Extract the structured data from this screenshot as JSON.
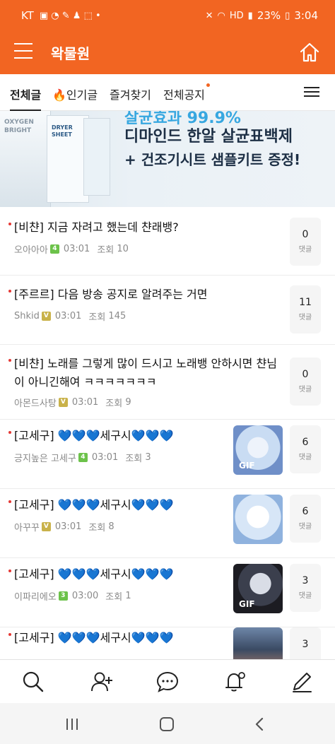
{
  "status_bar": {
    "carrier": "KT",
    "battery": "23%",
    "time": "3:04",
    "icons": [
      "mute-icon",
      "wifi-icon",
      "hd-icon",
      "signal-icon",
      "battery-icon"
    ]
  },
  "header": {
    "title": "왁물원",
    "menu_icon": "hamburger-icon",
    "home_icon": "home-icon",
    "color": "#f26522"
  },
  "tabs": [
    {
      "label": "전체글",
      "active": true
    },
    {
      "label": "🔥인기글",
      "active": false
    },
    {
      "label": "즐겨찾기",
      "active": false
    },
    {
      "label": "전체공지",
      "active": false,
      "new_dot": true
    }
  ],
  "banner": {
    "line1": "살균효과 99.9%",
    "line2": "디마인드 한알 살균표백제",
    "line3": "+ 건조기시트 샘플키트 증정!",
    "bottle_text": "OXYGEN BRIGHT",
    "pack_text": "DRYER SHEET"
  },
  "posts": [
    {
      "title": "[비챤] 지금 자려고 했는데 챤래뱅?",
      "author": "오아아아",
      "level": "4",
      "level_color": "#6cc24a",
      "time": "03:01",
      "views_label": "조회",
      "views": "10",
      "comments": "0",
      "comment_label": "댓글",
      "thumb": null
    },
    {
      "title": "[주르르] 다음 방송 공지로 알려주는 거면",
      "author": "Shkid",
      "level": "V",
      "level_color": "#c9b24a",
      "time": "03:01",
      "views_label": "조회",
      "views": "145",
      "comments": "11",
      "comment_label": "댓글",
      "thumb": null
    },
    {
      "title": "[비챤] 노래를 그렇게 많이 드시고 노래뱅 안하시면 챤님이 아니긴해여 ㅋㅋㅋㅋㅋㅋㅋ",
      "author": "아몬드사탕",
      "level": "V",
      "level_color": "#c9b24a",
      "time": "03:01",
      "views_label": "조회",
      "views": "9",
      "comments": "0",
      "comment_label": "댓글",
      "thumb": null
    },
    {
      "title": "[고세구] 💙💙💙세구시💙💙💙",
      "author": "긍지높은 고세구",
      "level": "4",
      "level_color": "#6cc24a",
      "time": "03:01",
      "views_label": "조회",
      "views": "3",
      "comments": "6",
      "comment_label": "댓글",
      "thumb": {
        "badge": "GIF",
        "palette": [
          "#c9dcf3",
          "#eef3fb",
          "#6f8fc8"
        ]
      }
    },
    {
      "title": "[고세구] 💙💙💙세구시💙💙💙",
      "author": "아꾸꾸",
      "level": "V",
      "level_color": "#c9b24a",
      "time": "03:01",
      "views_label": "조회",
      "views": "8",
      "comments": "6",
      "comment_label": "댓글",
      "thumb": {
        "badge": "",
        "palette": [
          "#d7e6f7",
          "#ffffff",
          "#8fb2de"
        ]
      }
    },
    {
      "title": "[고세구] 💙💙💙세구시💙💙💙",
      "author": "이파리에오",
      "level": "3",
      "level_color": "#6cc24a",
      "time": "03:00",
      "views_label": "조회",
      "views": "1",
      "comments": "3",
      "comment_label": "댓글",
      "thumb": {
        "badge": "GIF",
        "palette": [
          "#1c1c22",
          "#d9dde6",
          "#3b3f4d"
        ]
      }
    },
    {
      "title": "[고세구] 💙💙💙세구시💙💙💙",
      "author": "",
      "level": "",
      "level_color": "#6cc24a",
      "time": "",
      "views_label": "",
      "views": "",
      "comments": "3",
      "comment_label": "",
      "thumb": {
        "badge": "",
        "palette": [
          "#3a4a63",
          "#c98a6a",
          "#6e86a8"
        ]
      }
    }
  ],
  "bottom_nav": [
    "search-icon",
    "add-friend-icon",
    "chat-icon",
    "notification-settings-icon",
    "write-icon"
  ],
  "system_nav": [
    "recent-apps-icon",
    "home-button-icon",
    "back-icon"
  ]
}
